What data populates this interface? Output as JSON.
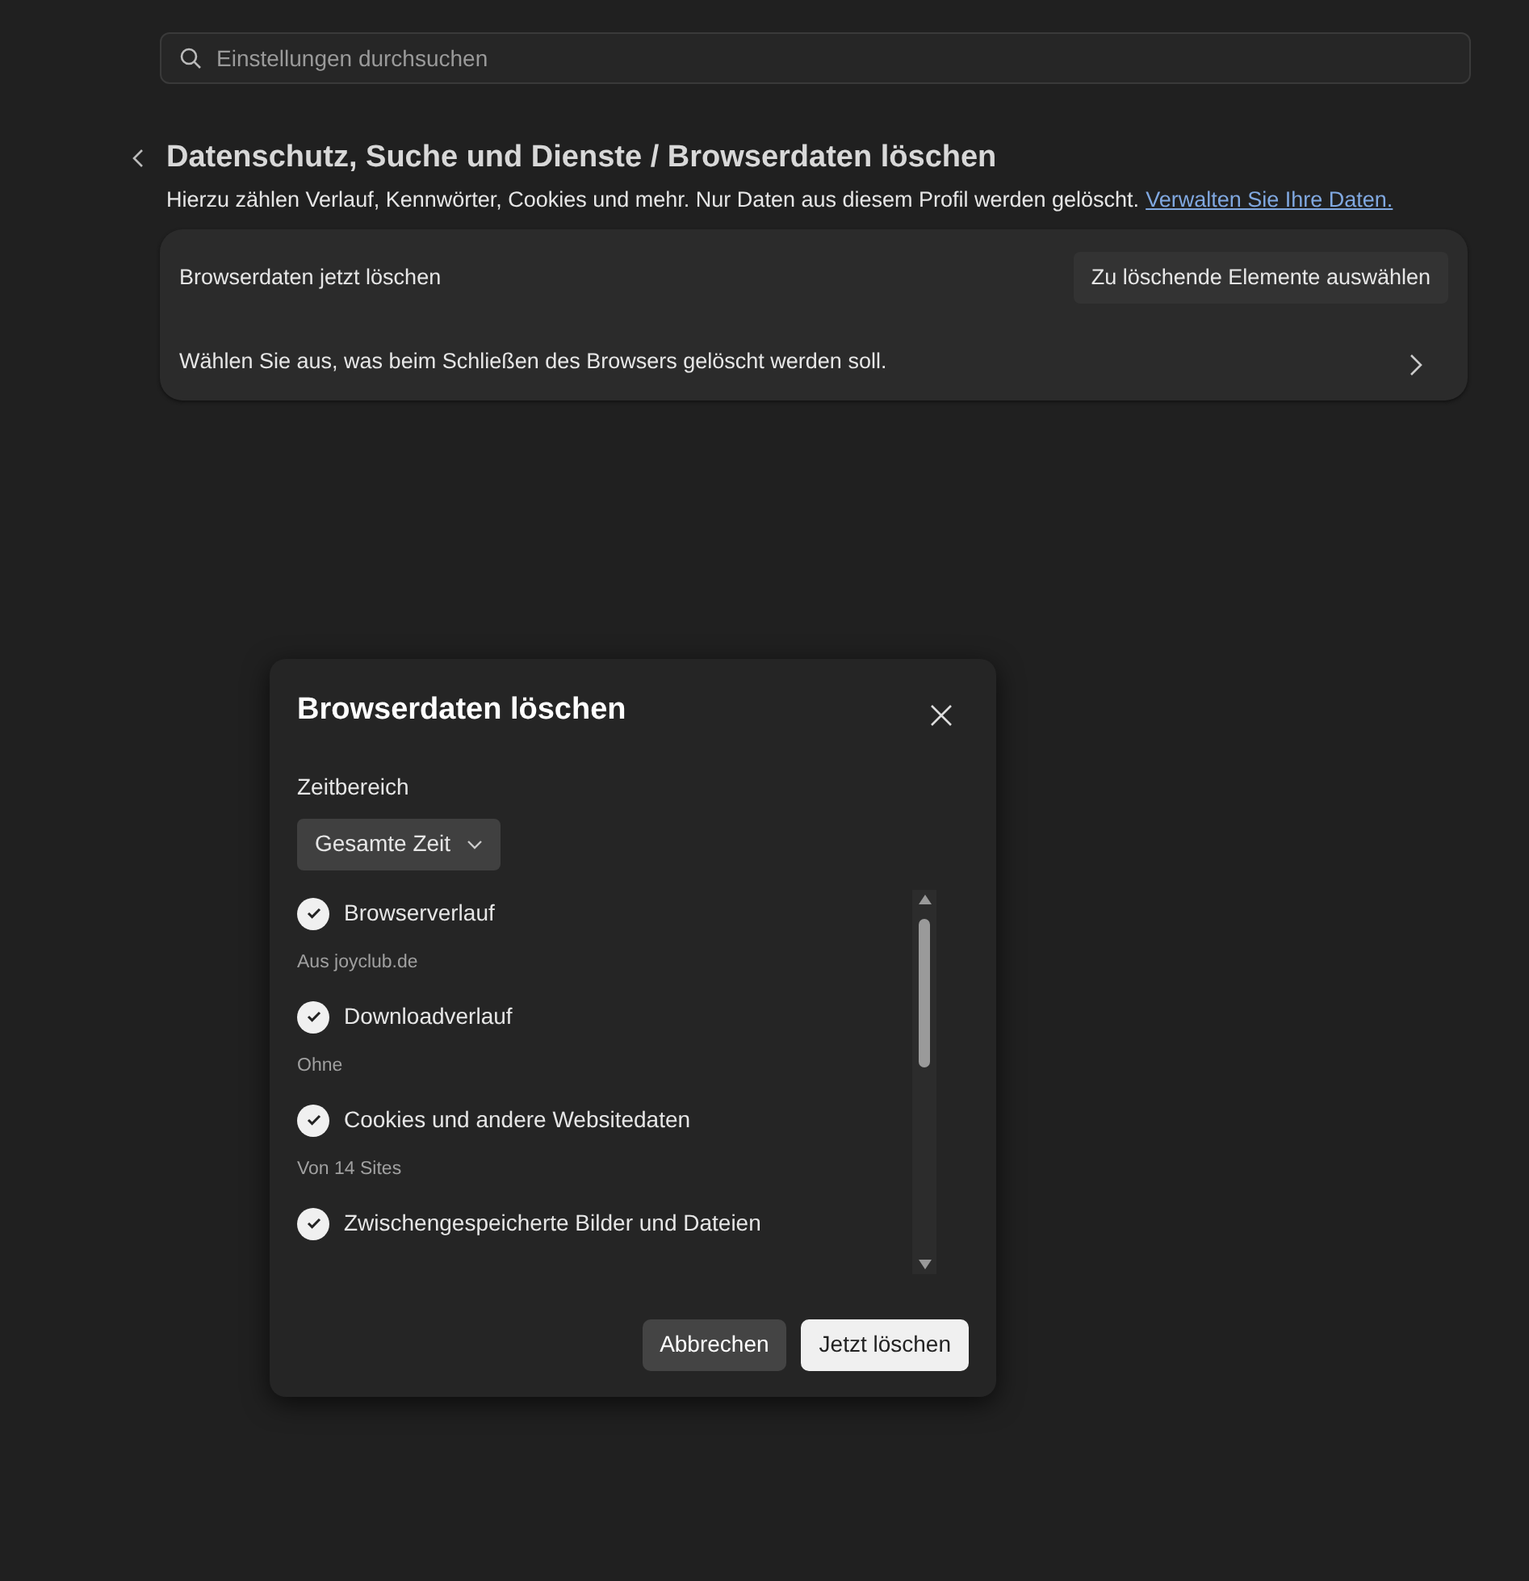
{
  "search": {
    "placeholder": "Einstellungen durchsuchen"
  },
  "header": {
    "title": "Datenschutz, Suche und Dienste / Browserdaten löschen",
    "description": "Hierzu zählen Verlauf, Kennwörter, Cookies und mehr. Nur Daten aus diesem Profil werden gelöscht.",
    "link": "Verwalten Sie Ihre Daten."
  },
  "card": {
    "rows": [
      {
        "kind": "button",
        "label": "Browserdaten jetzt löschen",
        "button": "Zu löschende Elemente auswählen"
      },
      {
        "kind": "chevron",
        "label": "Wählen Sie aus, was beim Schließen des Browsers gelöscht werden soll."
      }
    ]
  },
  "dialog": {
    "title": "Browserdaten löschen",
    "time_range": {
      "label": "Zeitbereich",
      "value": "Gesamte Zeit"
    },
    "items": [
      {
        "label": "Browserverlauf",
        "detail": "Aus joyclub.de",
        "checked": true
      },
      {
        "label": "Downloadverlauf",
        "detail": "Ohne",
        "checked": true
      },
      {
        "label": "Cookies und andere Websitedaten",
        "detail": "Von 14 Sites",
        "checked": true
      },
      {
        "label": "Zwischengespeicherte Bilder und Dateien",
        "checked": true
      }
    ],
    "buttons": [
      {
        "label": "Abbrechen",
        "kind": "secondary"
      },
      {
        "label": "Jetzt löschen",
        "kind": "primary"
      }
    ]
  }
}
